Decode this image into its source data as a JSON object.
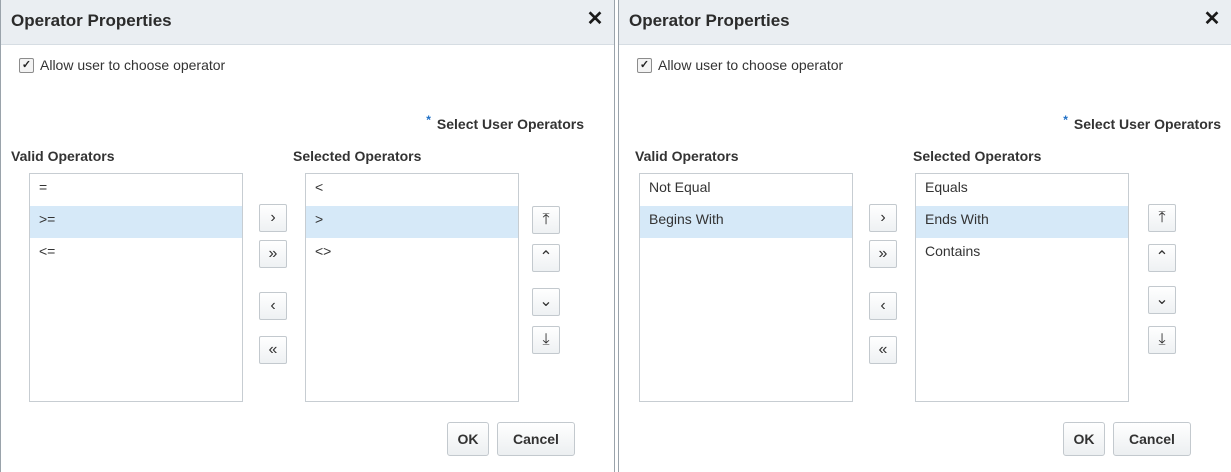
{
  "dialogs": [
    {
      "title": "Operator Properties",
      "close_glyph": "✕",
      "allow_choose": {
        "checked": true,
        "label": "Allow user to choose operator"
      },
      "required_marker": "*",
      "select_user_operators": "Select User Operators",
      "valid_label": "Valid Operators",
      "selected_label": "Selected Operators",
      "valid_items": [
        "=",
        ">=",
        "<="
      ],
      "valid_selected_index": 1,
      "selected_items": [
        "<",
        ">",
        "<>"
      ],
      "selected_selected_index": 1,
      "ok_label": "OK",
      "cancel_label": "Cancel"
    },
    {
      "title": "Operator Properties",
      "close_glyph": "✕",
      "allow_choose": {
        "checked": true,
        "label": "Allow user to choose operator"
      },
      "required_marker": "*",
      "select_user_operators": "Select User Operators",
      "valid_label": "Valid Operators",
      "selected_label": "Selected Operators",
      "valid_items": [
        "Not Equal",
        "Begins With"
      ],
      "valid_selected_index": 1,
      "selected_items": [
        "Equals",
        "Ends With",
        "Contains"
      ],
      "selected_selected_index": 1,
      "ok_label": "OK",
      "cancel_label": "Cancel"
    }
  ],
  "shuttle_icons": {
    "move_right": "›",
    "move_all_right": "»",
    "move_left": "‹",
    "move_all_left": "«"
  },
  "reorder_icons": {
    "move_top": "⤒",
    "move_up": "⌃",
    "move_down": "⌄",
    "move_bottom": "⤓"
  }
}
